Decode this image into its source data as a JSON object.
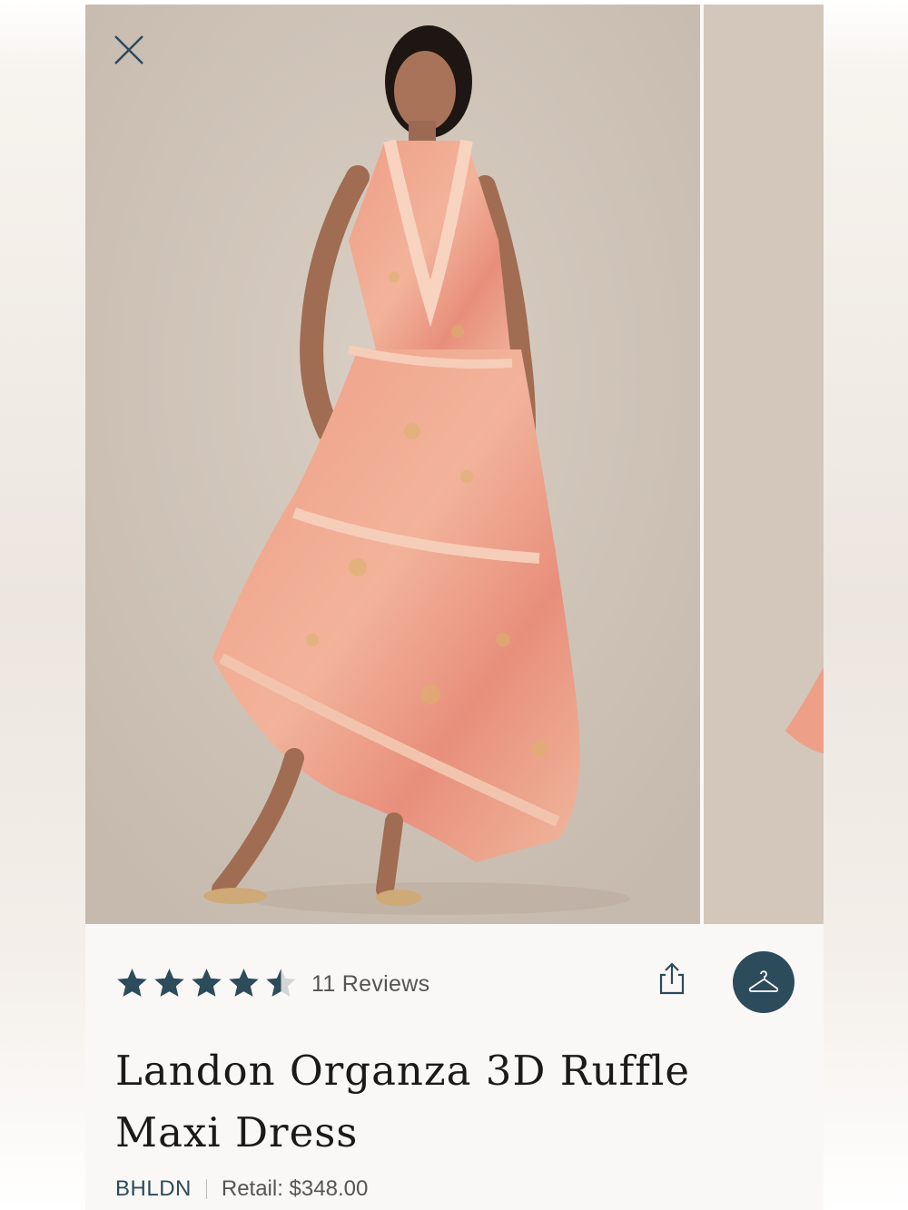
{
  "product": {
    "title": "Landon Organza 3D Ruffle Maxi Dress",
    "brand": "BHLDN",
    "retail": "Retail: $348.00",
    "rating": 4.5,
    "reviews_label": "11 Reviews"
  },
  "colors": {
    "accent": "#2c4b5b",
    "star": "#2c4b5b",
    "photo_bg": "#cfc3b7",
    "dress": "#e99a86"
  },
  "icons": {
    "close": "close-icon",
    "share": "share-icon",
    "hanger": "hanger-icon"
  }
}
